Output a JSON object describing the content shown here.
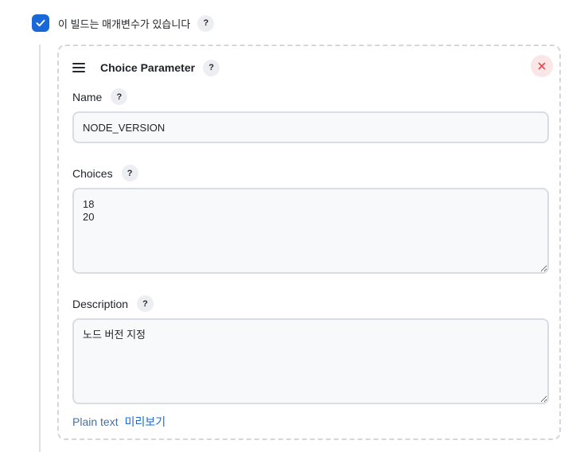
{
  "build_params": {
    "checkbox_label": "이 빌드는 매개변수가 있습니다",
    "checked": true,
    "help_glyph": "?"
  },
  "parameter": {
    "title": "Choice Parameter",
    "name": {
      "label": "Name",
      "value": "NODE_VERSION"
    },
    "choices": {
      "label": "Choices",
      "value": "18\n20"
    },
    "description": {
      "label": "Description",
      "value": "노드 버전 지정"
    },
    "format": {
      "text": "Plain text",
      "preview_label": "미리보기"
    }
  },
  "colors": {
    "accent": "#1868d8",
    "delete": "#e5484d",
    "delete_bg": "#fbe6e7"
  },
  "icons": {
    "checkbox": "check-icon",
    "drag": "drag-handle-icon",
    "delete": "close-icon",
    "help": "help-icon"
  }
}
